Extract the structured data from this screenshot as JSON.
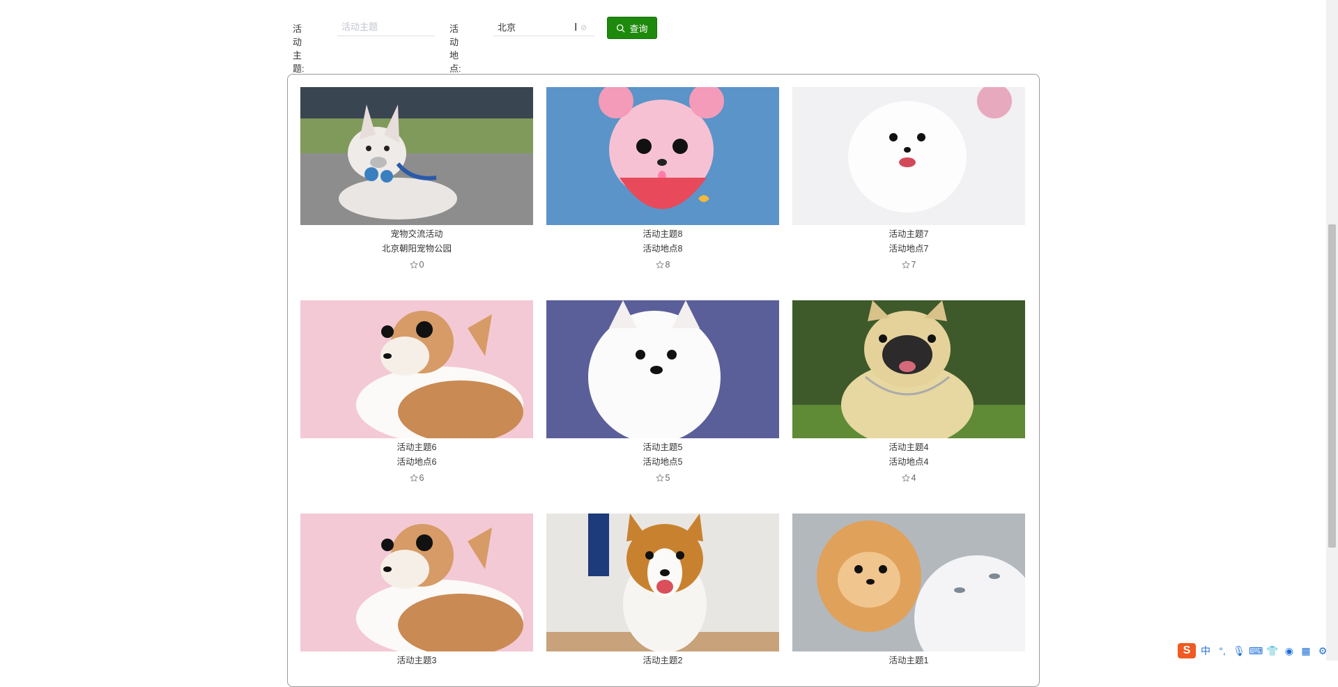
{
  "search": {
    "topic_label": "活动主题:",
    "topic_placeholder": "活动主题",
    "topic_value": "",
    "place_label": "活动地点:",
    "place_value": "北京",
    "query_label": "查询"
  },
  "cards": [
    {
      "title": "宠物交流活动",
      "place": "北京朝阳宠物公园",
      "favorites": "0",
      "image": "french-bulldog-puppy"
    },
    {
      "title": "活动主题8",
      "place": "活动地点8",
      "favorites": "8",
      "image": "pink-pomeranian-puppy"
    },
    {
      "title": "活动主题7",
      "place": "活动地点7",
      "favorites": "7",
      "image": "white-pomeranian-puppy"
    },
    {
      "title": "活动主题6",
      "place": "活动地点6",
      "favorites": "6",
      "image": "chihuahua-puppy"
    },
    {
      "title": "活动主题5",
      "place": "活动地点5",
      "favorites": "5",
      "image": "samoyed-puppy"
    },
    {
      "title": "活动主题4",
      "place": "活动地点4",
      "favorites": "4",
      "image": "french-bulldog-adult"
    },
    {
      "title": "活动主题3",
      "place": "",
      "favorites": "",
      "image": "chihuahua-puppy"
    },
    {
      "title": "活动主题2",
      "place": "",
      "favorites": "",
      "image": "corgi-puppy"
    },
    {
      "title": "活动主题1",
      "place": "",
      "favorites": "",
      "image": "orange-pomeranian-puppy"
    }
  ],
  "ime": {
    "logo": "S",
    "mode": "中",
    "punct": "°,"
  },
  "colors": {
    "primary_button": "#1e8a0d",
    "panel_border": "#999999"
  }
}
